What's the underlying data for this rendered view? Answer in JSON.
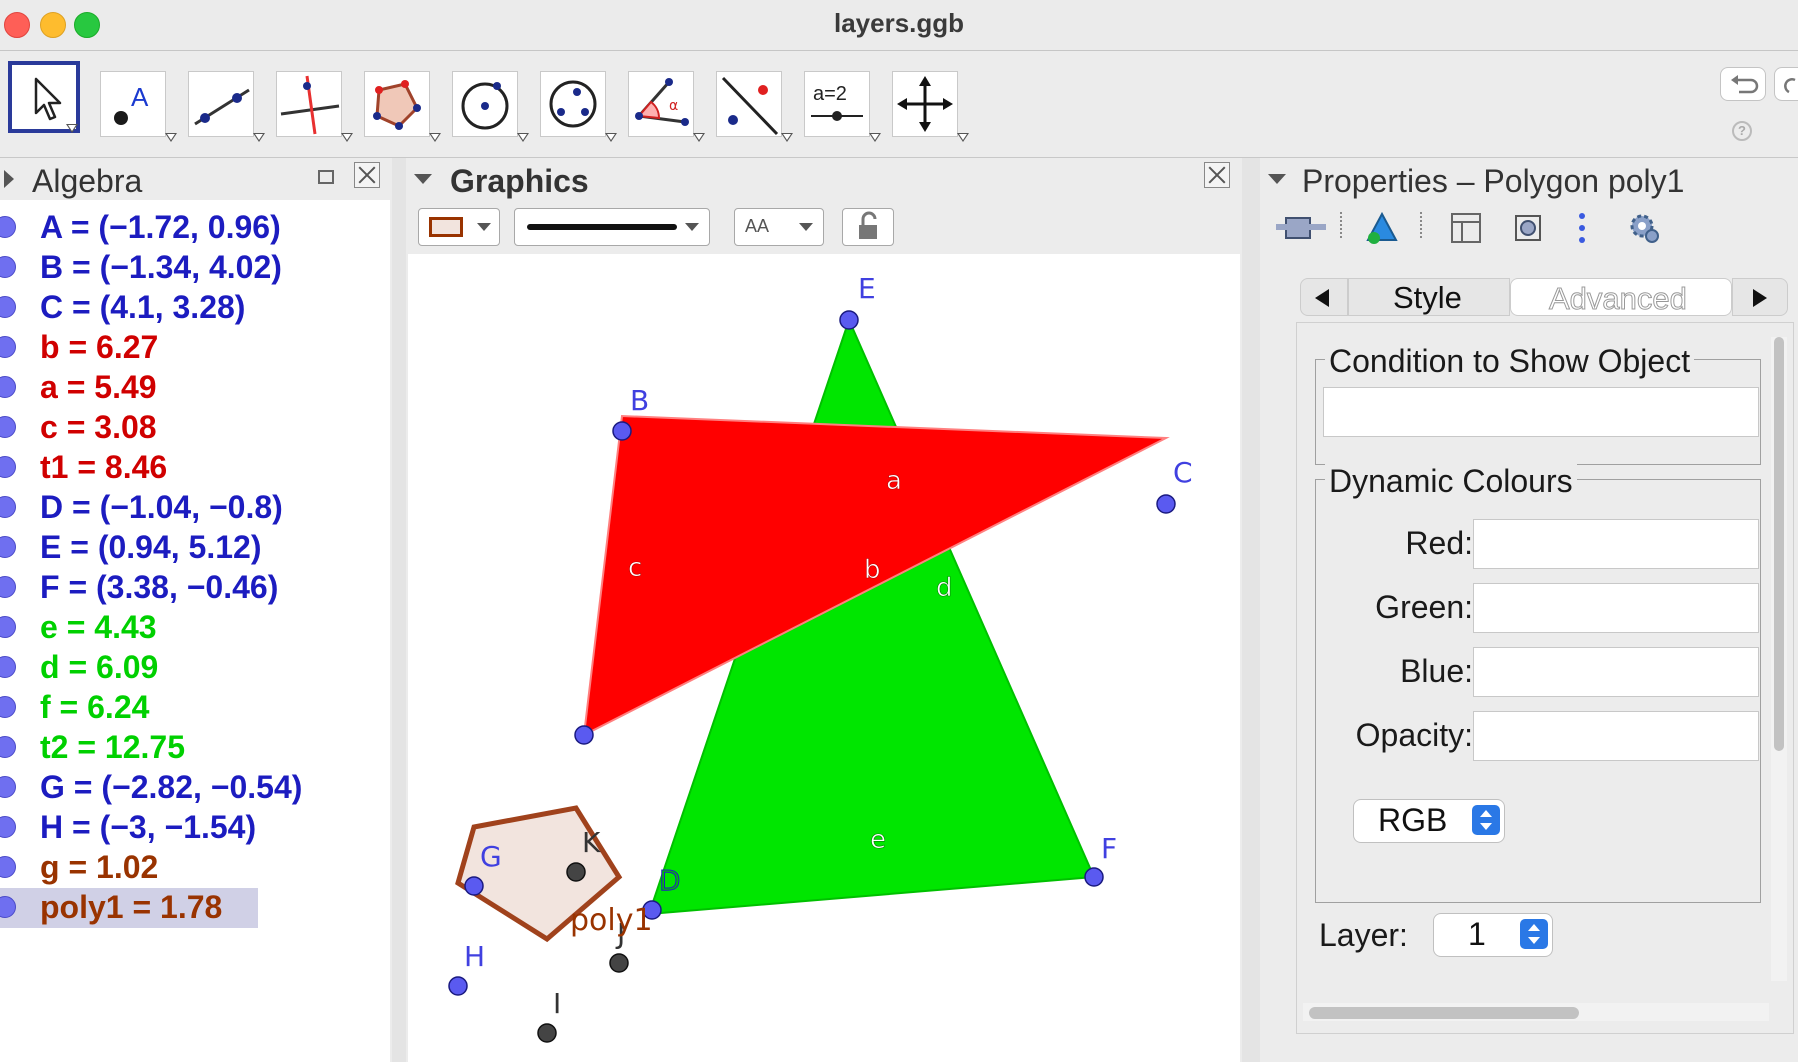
{
  "window": {
    "title": "layers.ggb"
  },
  "toolbar": {
    "tools": [
      "move",
      "point",
      "line",
      "perpendicular",
      "polygon",
      "circle",
      "conic",
      "angle",
      "reflect",
      "slider",
      "move-graphics"
    ],
    "slider_label": "a=2"
  },
  "algebra": {
    "title": "Algebra",
    "items": [
      {
        "text": "A = (−1.72, 0.96)",
        "color": "#1c1cc0"
      },
      {
        "text": "B = (−1.34, 4.02)",
        "color": "#1c1cc0"
      },
      {
        "text": "C = (4.1, 3.28)",
        "color": "#1c1cc0"
      },
      {
        "text": "b = 6.27",
        "color": "#d00000"
      },
      {
        "text": "a = 5.49",
        "color": "#d00000"
      },
      {
        "text": "c = 3.08",
        "color": "#d00000"
      },
      {
        "text": "t1 = 8.46",
        "color": "#d00000"
      },
      {
        "text": "D = (−1.04, −0.8)",
        "color": "#1c1cc0"
      },
      {
        "text": "E = (0.94, 5.12)",
        "color": "#1c1cc0"
      },
      {
        "text": "F = (3.38, −0.46)",
        "color": "#1c1cc0"
      },
      {
        "text": "e = 4.43",
        "color": "#00d000"
      },
      {
        "text": "d = 6.09",
        "color": "#00d000"
      },
      {
        "text": "f = 6.24",
        "color": "#00d000"
      },
      {
        "text": "t2 = 12.75",
        "color": "#00d000"
      },
      {
        "text": "G = (−2.82, −0.54)",
        "color": "#1c1cc0"
      },
      {
        "text": "H = (−3, −1.54)",
        "color": "#1c1cc0"
      },
      {
        "text": "g = 1.02",
        "color": "#993300"
      },
      {
        "text": "poly1 = 1.78",
        "color": "#993300",
        "selected": true
      }
    ]
  },
  "graphics": {
    "title": "Graphics",
    "style_bar": {
      "text_size_label": "AA"
    },
    "labels": {
      "E": "E",
      "B": "B",
      "C": "C",
      "D": "D",
      "F": "F",
      "G": "G",
      "K": "K",
      "H": "H",
      "I": "I",
      "J": "J",
      "seg_a": "a",
      "seg_b": "b",
      "seg_c": "c",
      "seg_d": "d",
      "seg_e": "e",
      "poly1": "poly1"
    },
    "colors": {
      "red_triangle": "#ff0000",
      "green_triangle": "#00e600",
      "poly_stroke": "#993300",
      "poly_fill": "#f2e4de",
      "point": "#5a5af0"
    }
  },
  "properties": {
    "title": "Properties – Polygon poly1",
    "tabs": {
      "style": "Style",
      "advanced": "Advanced"
    },
    "condition_title": "Condition to Show Object",
    "condition_value": "",
    "dynamic_title": "Dynamic Colours",
    "red_label": "Red:",
    "green_label": "Green:",
    "blue_label": "Blue:",
    "opacity_label": "Opacity:",
    "color_model": "RGB",
    "layer_label": "Layer:",
    "layer_value": "1"
  }
}
